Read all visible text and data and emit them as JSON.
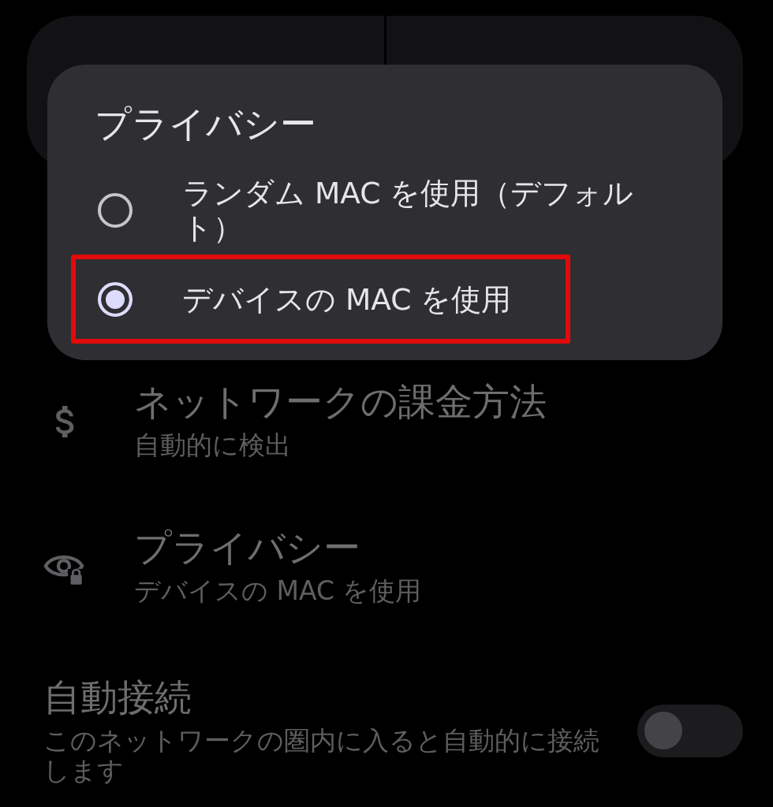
{
  "dialog": {
    "title": "プライバシー",
    "options": [
      {
        "label": "ランダム MAC を使用（デフォルト）",
        "selected": false,
        "highlighted": false
      },
      {
        "label": "デバイスの MAC を使用",
        "selected": true,
        "highlighted": true
      }
    ]
  },
  "settings": [
    {
      "kind": "link",
      "title": "ネットワークの課金方法",
      "summary": "自動的に検出"
    },
    {
      "kind": "link",
      "title": "プライバシー",
      "summary": "デバイスの MAC を使用"
    },
    {
      "kind": "switch",
      "title": "自動接続",
      "summary": "このネットワークの圏内に入ると自動的に接続します",
      "on": false
    }
  ]
}
